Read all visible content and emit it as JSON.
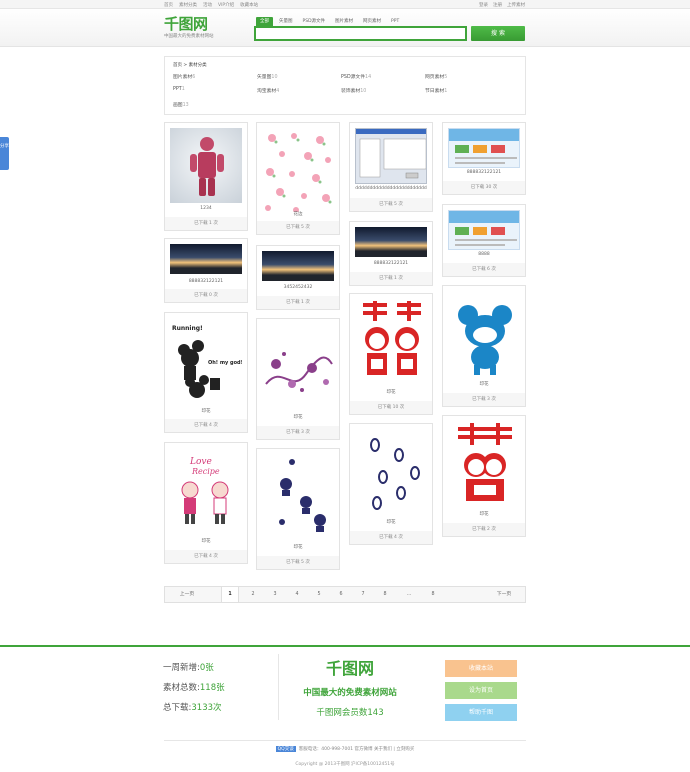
{
  "topbar": {
    "left_links": [
      "首页",
      "素材分类",
      "活动",
      "VIP介绍",
      "收藏本站"
    ],
    "right_links": [
      "登录",
      "注册",
      "上传素材"
    ]
  },
  "header": {
    "logo_text": "千图网",
    "slogan": "中国最大的免费素材网站",
    "search_tabs": [
      "全部",
      "矢量图",
      "PSD源文件",
      "图片素材",
      "网页素材",
      "PPT"
    ],
    "active_tab": "全部",
    "search_placeholder": "",
    "search_button": "搜 索"
  },
  "side_share": "分享",
  "categories": {
    "breadcrumb": "首页 > 素材分类",
    "items": [
      {
        "label": "图片素材",
        "count": "6"
      },
      {
        "label": "矢量图",
        "count": "10"
      },
      {
        "label": "PSD源文件",
        "count": "14"
      },
      {
        "label": "网页素材",
        "count": "5"
      },
      {
        "label": "PPT",
        "count": "1"
      },
      {
        "label": "淘宝素材",
        "count": "4"
      },
      {
        "label": "装饰素材",
        "count": "10"
      },
      {
        "label": "节日素材",
        "count": "1"
      },
      {
        "label": "画图",
        "count": "13"
      }
    ]
  },
  "cards": [
    {
      "title": "1234",
      "downloads": "已下载 1 次",
      "thumb": "person-mosaic"
    },
    {
      "title": "888832122121",
      "downloads": "已下载 0 次",
      "thumb": "sunset"
    },
    {
      "title": "印花",
      "downloads": "已下载 4 次",
      "thumb": "mickey"
    },
    {
      "title": "印花",
      "downloads": "已下载 4 次",
      "thumb": "love-couple"
    },
    {
      "title": "花边",
      "downloads": "已下载 5 次",
      "thumb": "flowers"
    },
    {
      "title": "3452452432",
      "downloads": "已下载 1 次",
      "thumb": "sunset"
    },
    {
      "title": "印花",
      "downloads": "已下载 3 次",
      "thumb": "vine"
    },
    {
      "title": "印花",
      "downloads": "已下载 5 次",
      "thumb": "cats"
    },
    {
      "title": "ddddddddddddddddddddddddd",
      "downloads": "已下载 5 次",
      "thumb": "screenshot"
    },
    {
      "title": "888832122121",
      "downloads": "已下载 1 次",
      "thumb": "sunset"
    },
    {
      "title": "印花",
      "downloads": "已下载 10 次",
      "thumb": "xi-kids"
    },
    {
      "title": "印花",
      "downloads": "已下载 4 次",
      "thumb": "footprints"
    },
    {
      "title": "888832122121",
      "downloads": "已下载 30 次",
      "thumb": "webpage"
    },
    {
      "title": "8888",
      "downloads": "已下载 6 次",
      "thumb": "webpage"
    },
    {
      "title": "印花",
      "downloads": "已下载 3 次",
      "thumb": "mouse"
    },
    {
      "title": "印花",
      "downloads": "已下载 2 次",
      "thumb": "xi-kiss"
    }
  ],
  "pager": {
    "prev": "上一页",
    "pages": [
      "1",
      "2",
      "3",
      "4",
      "5",
      "6",
      "7",
      "8",
      "...",
      "8"
    ],
    "current": "1",
    "next": "下一页"
  },
  "footer": {
    "stats": [
      {
        "label": "一周新增:",
        "value": "0张"
      },
      {
        "label": "素材总数:",
        "value": "118张"
      },
      {
        "label": "总下载:",
        "value": "3133次"
      }
    ],
    "logo_text": "千图网",
    "tagline": "中国最大的免费素材网站",
    "members": "千图网会员数143",
    "buttons": [
      {
        "label": "收藏本站",
        "color": "#f9c38f"
      },
      {
        "label": "设为首页",
        "color": "#a9d98c"
      },
      {
        "label": "帮助千图",
        "color": "#8fd1f0"
      }
    ],
    "contact": "客服电话：400-998-7001  官方微博  关于我们 | 立刻购买",
    "qq_label": "QQ交谈",
    "copyright": "Copyright @ 2013千图网 沪ICP备10012451号"
  },
  "colors": {
    "accent": "#3fa43a",
    "share": "#4a86d8"
  }
}
